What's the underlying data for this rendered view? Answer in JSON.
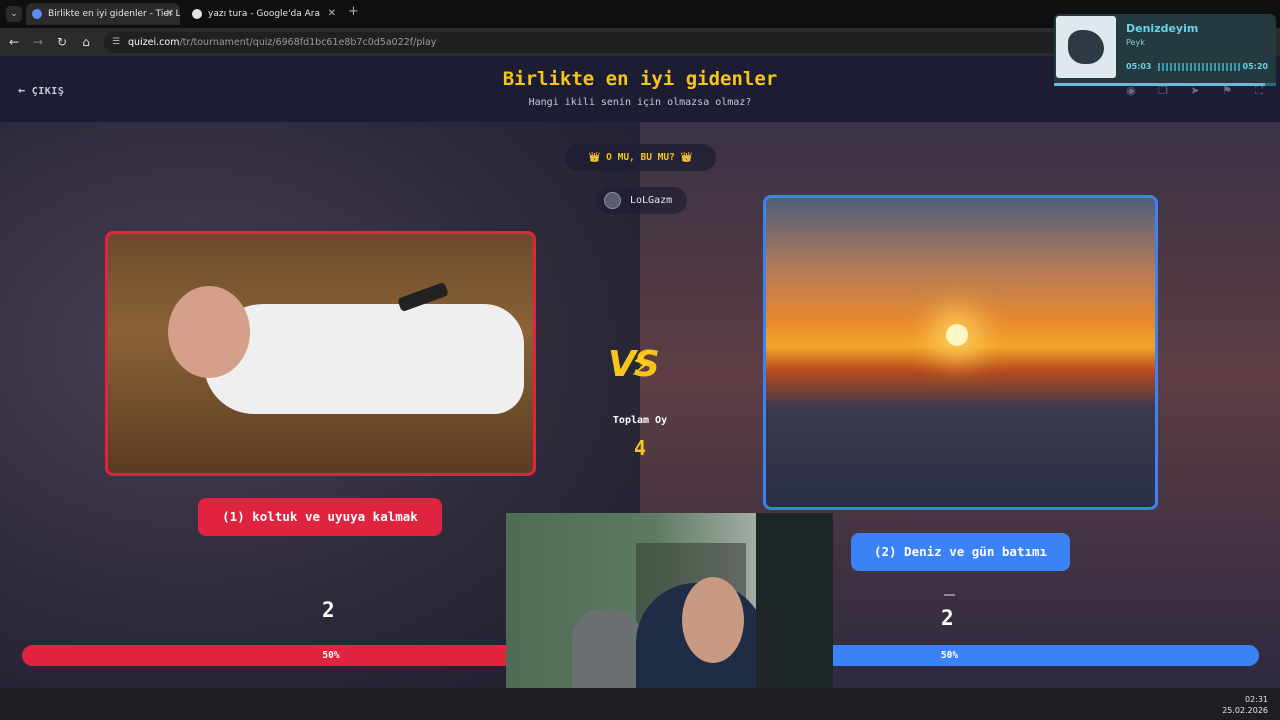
{
  "browser": {
    "tabs": [
      {
        "label": "Birlikte en iyi gidenler - Tier List",
        "active": true
      },
      {
        "label": "yazı tura - Google'da Ara",
        "active": false
      }
    ],
    "url_host": "quizei.com",
    "url_path": "/tr/tournament/quiz/6968fd1bc61e8b7c0d5a022f/play"
  },
  "header": {
    "exit_label": "ÇIKIŞ",
    "title": "Birlikte en iyi gidenler",
    "subtitle": "Hangi ikili senin için olmazsa olmaz?"
  },
  "round": {
    "pill": "👑 O MU, BU MU? 👑",
    "username": "LoLGazm"
  },
  "left": {
    "label": "(1) koltuk ve uyuya kalmak",
    "votes": "2",
    "percent": "50%"
  },
  "right": {
    "label": "(2) Deniz ve gün batımı",
    "votes": "2",
    "percent": "50%"
  },
  "center": {
    "vs": "VS",
    "total_label": "Toplam Oy",
    "total_value": "4"
  },
  "music": {
    "title": "Denizdeyim",
    "artist": "Peyk",
    "elapsed": "05:03",
    "duration": "05:20",
    "progress": 0.95
  },
  "taskbar": {
    "time": "02:31",
    "date": "25.02.2026"
  },
  "colors": {
    "accent_yellow": "#f5c518",
    "left_red": "#e0243f",
    "right_blue": "#3b82f6",
    "header_bg": "#1c1c33"
  },
  "icons": [
    "eye-icon",
    "copy-icon",
    "share-icon",
    "flag-icon",
    "fullscreen-icon"
  ]
}
